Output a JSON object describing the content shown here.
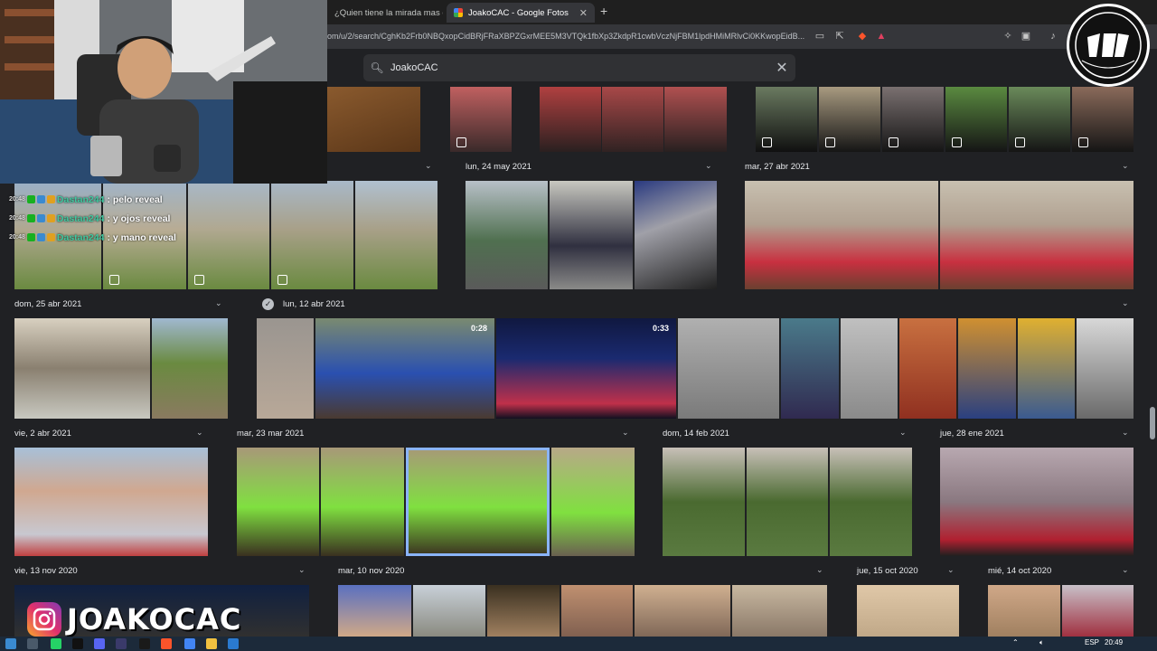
{
  "browser": {
    "tabs": [
      {
        "title": "¿Quien tiene la mirada mas cansa",
        "active": false
      },
      {
        "title": "JoakoCAC - Google Fotos",
        "active": true
      }
    ],
    "new_tab_label": "+",
    "url": "om/u/2/search/CghKb2Frb0NBQxopCidBRjFRaXBPZGxrMEE5M3VTQk1fbXp3ZkdpR1cwbVczNjFBM1lpdHMiMRlvCi0KKwopEidB..."
  },
  "photos": {
    "search_query": "JoakoCAC",
    "sections": [
      {
        "date": "lun, 24 may 2021"
      },
      {
        "date": "mar, 27 abr 2021"
      },
      {
        "date": "dom, 25 abr 2021"
      },
      {
        "date": "lun, 12 abr 2021"
      },
      {
        "date": "vie, 2 abr 2021"
      },
      {
        "date": "mar, 23 mar 2021"
      },
      {
        "date": "dom, 14 feb 2021"
      },
      {
        "date": "jue, 28 ene 2021"
      },
      {
        "date": "vie, 13 nov 2020"
      },
      {
        "date": "mar, 10 nov 2020"
      },
      {
        "date": "jue, 15 oct 2020"
      },
      {
        "date": "mié, 14 oct 2020"
      }
    ],
    "video_durations": [
      "0:28",
      "0:33"
    ]
  },
  "overlay": {
    "chat": [
      {
        "time": "20:48",
        "user": "Dastan244",
        "message": ": pelo reveal"
      },
      {
        "time": "20:48",
        "user": "Dastan244",
        "message": ": y ojos reveal"
      },
      {
        "time": "20:48",
        "user": "Dastan244",
        "message": ": y mano reveal"
      }
    ],
    "handle": "JOAKOCAC"
  },
  "taskbar": {
    "language": "ESP",
    "time": "20:49"
  },
  "colors": {
    "background": "#202124",
    "chat_username": "#40c8a0",
    "selection": "#8ab4f8"
  }
}
